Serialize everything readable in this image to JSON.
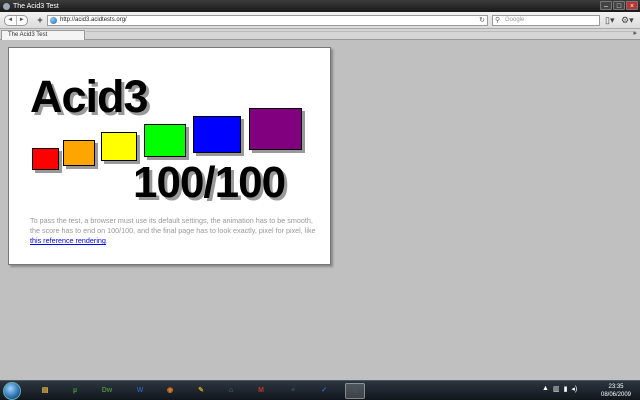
{
  "window": {
    "title": "The Acid3 Test"
  },
  "toolbar": {
    "back_glyph": "◄",
    "forward_glyph": "►",
    "add_glyph": "+",
    "url": "http://acid3.acidtests.org/",
    "search_placeholder": "Google",
    "reload_glyph": "↻"
  },
  "tabs": [
    {
      "label": "The Acid3 Test"
    }
  ],
  "page": {
    "heading": "Acid3",
    "score": "100/100",
    "description": "To pass the test, a browser must use its default settings, the animation has to be smooth, the score has to end on 100/100, and the final page has to look exactly, pixel for pixel, like",
    "link_text": "this reference rendering",
    "trailing": ".",
    "squares": [
      {
        "color": "#ff0000"
      },
      {
        "color": "#ffa500"
      },
      {
        "color": "#ffff00"
      },
      {
        "color": "#00ff00"
      },
      {
        "color": "#0000ff"
      },
      {
        "color": "#800080"
      }
    ]
  },
  "taskbar": {
    "items": [
      {
        "name": "explorer",
        "glyph": "▤",
        "color": "#e8b84a"
      },
      {
        "name": "utorrent",
        "glyph": "µ",
        "color": "#3a9a3a"
      },
      {
        "name": "dreamweaver",
        "glyph": "Dw",
        "color": "#4a8a3a"
      },
      {
        "name": "word",
        "glyph": "W",
        "color": "#2a5aa8"
      },
      {
        "name": "firefox",
        "glyph": "◉",
        "color": "#e8782a"
      },
      {
        "name": "pencil",
        "glyph": "✎",
        "color": "#c89a2a"
      },
      {
        "name": "network",
        "glyph": "⌂",
        "color": "#5a7aaa"
      },
      {
        "name": "gmail",
        "glyph": "M",
        "color": "#c0392b"
      },
      {
        "name": "notes",
        "glyph": "≡",
        "color": "#555555"
      },
      {
        "name": "check",
        "glyph": "✓",
        "color": "#2a6ac8"
      },
      {
        "name": "browser",
        "glyph": "◌",
        "color": "#6a7a8a"
      }
    ],
    "clock_time": "23:35",
    "clock_date": "08/06/2009"
  }
}
